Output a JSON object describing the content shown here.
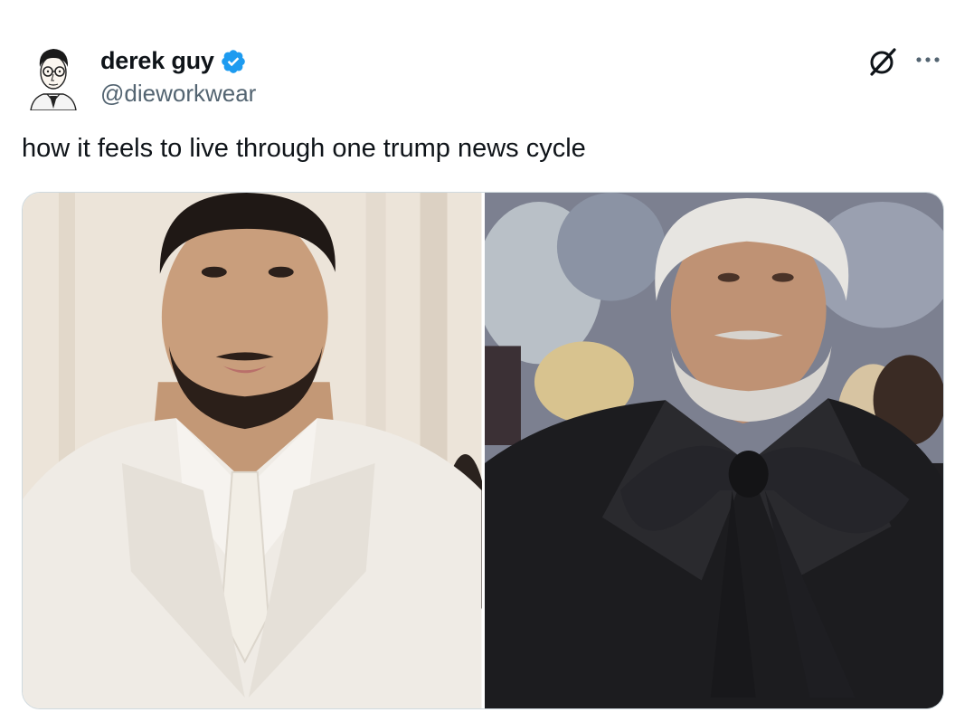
{
  "author": {
    "display_name": "derek guy",
    "handle": "@dieworkwear",
    "verified": true,
    "avatar_icon": "illustrated-portrait-avatar"
  },
  "header_actions": {
    "grok_icon": "grok-icon",
    "more_icon": "more-horizontal-icon"
  },
  "tweet": {
    "text": "how it feels to live through one trump news cycle"
  },
  "media": [
    {
      "name": "young-man-white-suit-photo",
      "background_color": "#e9e1d6",
      "suit_color": "#efeae3"
    },
    {
      "name": "aged-man-black-suit-bow-photo",
      "background_color": "#7d8193",
      "suit_color": "#1c1c1f"
    }
  ],
  "colors": {
    "verified_blue": "#1d9bf0",
    "text_primary": "#0f1419",
    "text_secondary": "#536471",
    "border": "#cfd9de"
  }
}
